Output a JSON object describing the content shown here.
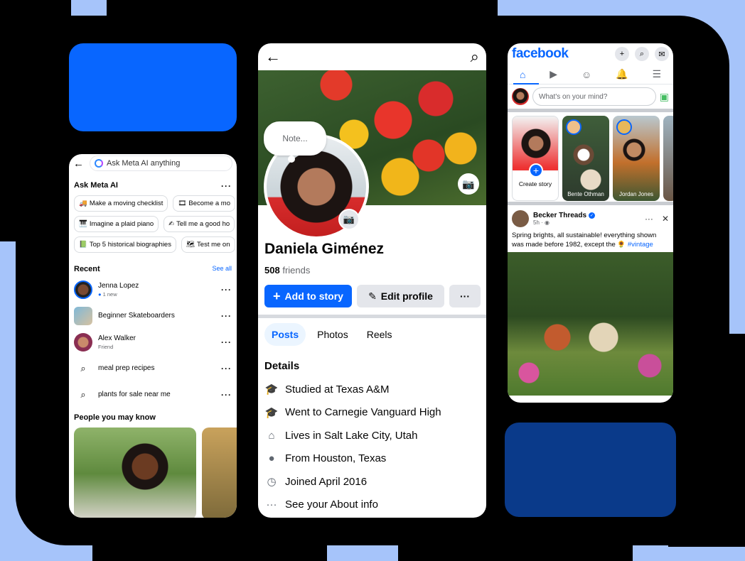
{
  "colors": {
    "accent": "#0866ff",
    "brand_dark": "#0a3a8a"
  },
  "left_phone": {
    "search_placeholder": "Ask Meta AI anything",
    "section_title": "Ask Meta AI",
    "chips": [
      [
        "Make a moving checklist",
        "Become a mo"
      ],
      [
        "Imagine a plaid piano",
        "Tell me a good ho"
      ],
      [
        "Top 5 historical biographies",
        "Test me on"
      ]
    ],
    "recent_title": "Recent",
    "see_all": "See all",
    "recent": [
      {
        "name": "Jenna Lopez",
        "sub": "1 new",
        "icon": "avatar"
      },
      {
        "name": "Beginner Skateboarders",
        "sub": "",
        "icon": "group-avatar"
      },
      {
        "name": "Alex Walker",
        "sub": "Friend",
        "icon": "avatar"
      },
      {
        "name": "meal prep recipes",
        "sub": "",
        "icon": "search-icon"
      },
      {
        "name": "plants for sale near me",
        "sub": "",
        "icon": "search-icon"
      }
    ],
    "pymk_title": "People you may know"
  },
  "middle_phone": {
    "note": "Note...",
    "name": "Daniela Giménez",
    "friends_count": "508",
    "friends_label": "friends",
    "add_story": "Add to story",
    "edit_profile": "Edit profile",
    "more": "···",
    "tabs": [
      "Posts",
      "Photos",
      "Reels"
    ],
    "details_title": "Details",
    "details": [
      {
        "icon": "education-icon",
        "text": "Studied at Texas A&M"
      },
      {
        "icon": "education-icon",
        "text": "Went to Carnegie Vanguard High"
      },
      {
        "icon": "home-icon",
        "text": "Lives in Salt Lake City, Utah"
      },
      {
        "icon": "location-icon",
        "text": "From Houston, Texas"
      },
      {
        "icon": "clock-icon",
        "text": "Joined April 2016"
      },
      {
        "icon": "more-icon",
        "text": "See your About info"
      }
    ]
  },
  "right_phone": {
    "logo": "facebook",
    "composer_placeholder": "What's on your mind?",
    "create_story": "Create story",
    "stories": [
      "Bente Othman",
      "Jordan Jones"
    ],
    "post": {
      "author": "Becker Threads",
      "time": "5h ·",
      "text": "Spring brights, all sustainable! everything shown was made before 1982, except the",
      "hashtag": "#vintage"
    }
  }
}
